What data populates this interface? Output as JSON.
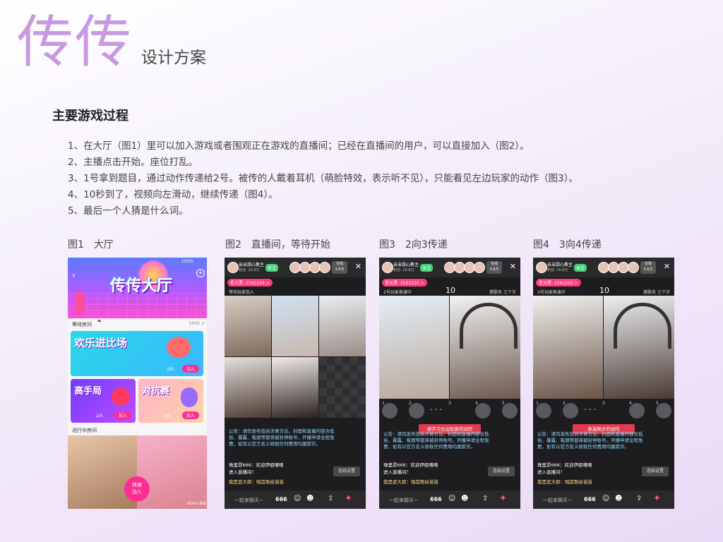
{
  "header": {
    "logo": "传传",
    "subtitle": "设计方案"
  },
  "section": {
    "title": "主要游戏过程",
    "steps": [
      "1、在大厅（图1）里可以加入游戏或者围观正在游戏的直播间；已经在直播间的用户，可以直接加入（图2）。",
      "2、主播点击开始。座位打乱。",
      "3、1号拿到题目，通过动作传递给2号。被传的人戴着耳机（萌脸特效，表示听不见），只能看见左边玩家的动作（图3）。",
      "4、10秒到了，视频向左滑动，继续传递（图4）。",
      "5、最后一个人猜是什么词。"
    ]
  },
  "figures": {
    "f1": {
      "label": "图1　大厅",
      "banner_title": "传传大厅",
      "status_time": "100%",
      "waiting_label": "等待房间",
      "waiting_count": "1045 >",
      "card1_title": "欢乐进比场",
      "card2_title": "高手局",
      "card3_title": "对抗赛",
      "join_label": "加入",
      "card_count": "2/5",
      "inprogress_label": "进行中房间",
      "fast_join": "快速\n加入",
      "viewers": "2634人观看"
    },
    "f2": {
      "label": "图2　直播间，等待开始",
      "host_name": "亲亲甜心教主",
      "host_sub": "粉丝: 16.8万",
      "follow": "关注",
      "online": "在线\n3.6万",
      "stars": "星光票: 2562220 >",
      "waiting": "等待玩家加入",
      "notice": "公告：请勿发布低俗涉黄言论。封面和直播内容含低俗、暴露、吸烟等都将被封停账号。开播申请全程免费，如有以官方名义收取任何费用均属欺诈。",
      "chat1": "珠里昂666：欢迎伊姐嘻嘻",
      "chat1b": "进入直播间！",
      "chat2": "我是武大郎：唱首歌给苗苗",
      "settings": "连线设置",
      "input": "一起来聊天~",
      "gift666": "666"
    },
    "f3": {
      "label": "图3　2向3传递",
      "status": "2号玩家表演中",
      "timer": "10",
      "guess": "猜歌名 三个字",
      "tip": "请学习左边玩家的动作",
      "notice": "公告：请勿发布低俗涉黄言论。封面和直播内容含低俗、暴露、吸烟等都将被封停账号。开播申请全程免费，如有以官方名义收取任何费用均属欺诈。",
      "chat1": "珠里昂666：欢迎伊姐嘻嘻",
      "chat1b": "进入直播间！",
      "chat2": "我是武大郎：唱首歌给苗苗",
      "settings": "连线设置",
      "input": "一起来聊天~",
      "gift666": "666",
      "seat_labels": [
        "1",
        "2",
        "3",
        "4",
        "5"
      ]
    },
    "f4": {
      "label": "图4　3向4传递",
      "status": "3号玩家表演中",
      "timer": "10",
      "guess": "猜歌名 三个字",
      "tip": "表演刚才的动作",
      "notice": "公告：请勿发布低俗涉黄言论。封面和直播内容含低俗、暴露、吸烟等都将被封停账号。开播申请全程免费，如有以官方名义收取任何费用均属欺诈。",
      "chat1": "珠里昂666：欢迎伊姐嘻嘻",
      "chat1b": "进入直播间！",
      "chat2": "我是武大郎：唱首歌给苗苗",
      "settings": "连线设置",
      "input": "一起来聊天~",
      "gift666": "666",
      "seat_labels": [
        "1",
        "2",
        "3",
        "4",
        "5"
      ]
    }
  },
  "colors": {
    "logo": "#c79ae0",
    "accent": "#ff2d92",
    "phone_bg": "#1d1d1f"
  }
}
